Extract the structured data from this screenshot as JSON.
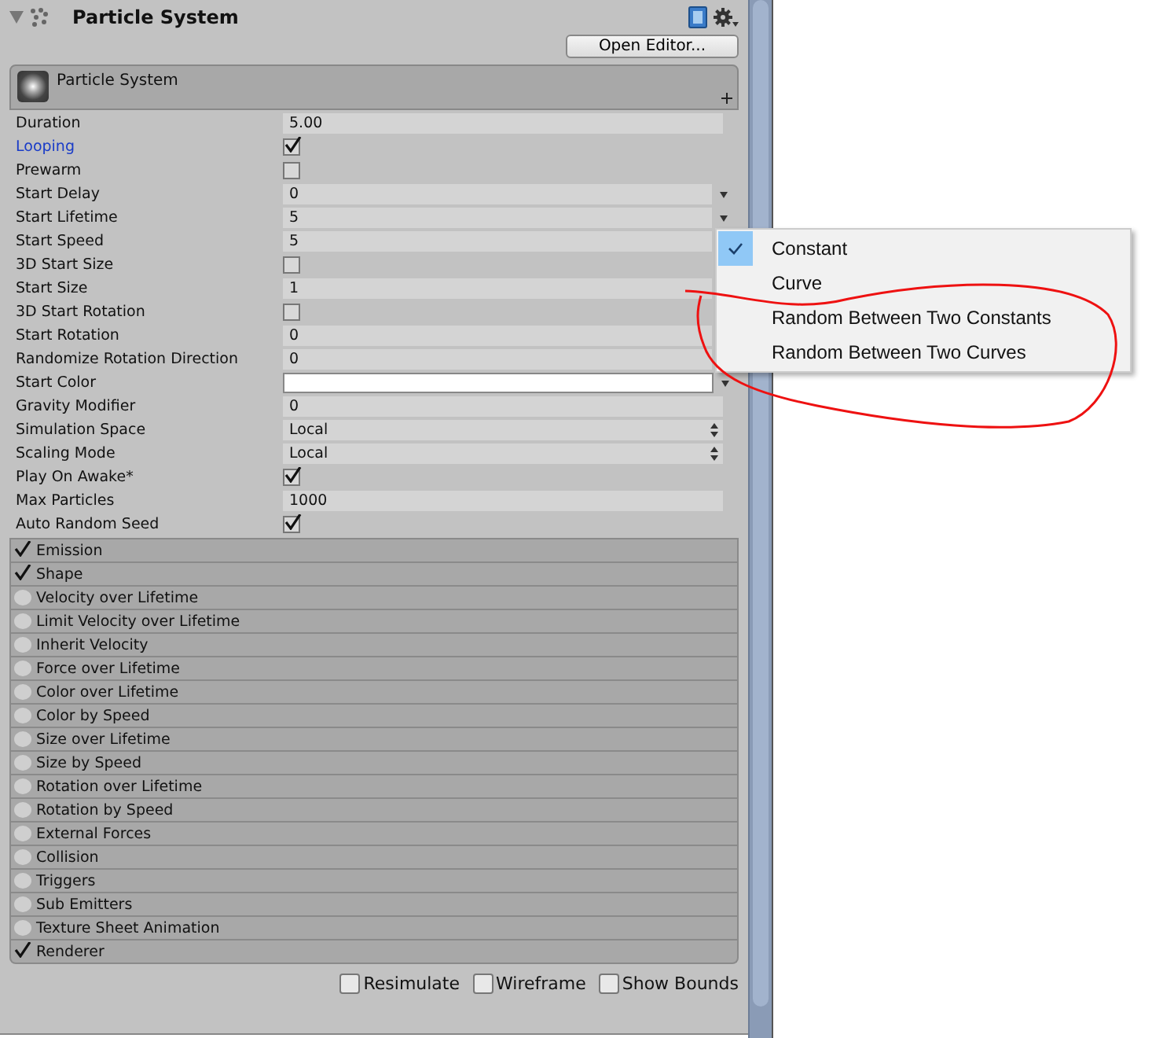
{
  "component": {
    "title": "Particle System",
    "button": "Open Editor..."
  },
  "module_header": {
    "title": "Particle System"
  },
  "properties": [
    {
      "label": "Duration",
      "kind": "number",
      "value": "5.00"
    },
    {
      "label": "Looping",
      "kind": "checkbox",
      "checked": true,
      "highlighted": true
    },
    {
      "label": "Prewarm",
      "kind": "checkbox",
      "checked": false
    },
    {
      "label": "Start Delay",
      "kind": "curve",
      "value": "0"
    },
    {
      "label": "Start Lifetime",
      "kind": "curve",
      "value": "5"
    },
    {
      "label": "Start Speed",
      "kind": "curve",
      "value": "5"
    },
    {
      "label": "3D Start Size",
      "kind": "checkbox",
      "checked": false
    },
    {
      "label": "Start Size",
      "kind": "curve",
      "value": "1"
    },
    {
      "label": "3D Start Rotation",
      "kind": "checkbox",
      "checked": false
    },
    {
      "label": "Start Rotation",
      "kind": "curve",
      "value": "0"
    },
    {
      "label": "Randomize Rotation Direction",
      "kind": "curve",
      "value": "0"
    },
    {
      "label": "Start Color",
      "kind": "color",
      "color": "#ffffff"
    },
    {
      "label": "Gravity Modifier",
      "kind": "number",
      "value": "0"
    },
    {
      "label": "Simulation Space",
      "kind": "enum",
      "value": "Local"
    },
    {
      "label": "Scaling Mode",
      "kind": "enum",
      "value": "Local"
    },
    {
      "label": "Play On Awake*",
      "kind": "checkbox",
      "checked": true
    },
    {
      "label": "Max Particles",
      "kind": "number",
      "value": "1000"
    },
    {
      "label": "Auto Random Seed",
      "kind": "checkbox",
      "checked": true
    }
  ],
  "modules": [
    {
      "label": "Emission",
      "enabled": true
    },
    {
      "label": "Shape",
      "enabled": true
    },
    {
      "label": "Velocity over Lifetime",
      "enabled": false
    },
    {
      "label": "Limit Velocity over Lifetime",
      "enabled": false
    },
    {
      "label": "Inherit Velocity",
      "enabled": false
    },
    {
      "label": "Force over Lifetime",
      "enabled": false
    },
    {
      "label": "Color over Lifetime",
      "enabled": false
    },
    {
      "label": "Color by Speed",
      "enabled": false
    },
    {
      "label": "Size over Lifetime",
      "enabled": false
    },
    {
      "label": "Size by Speed",
      "enabled": false
    },
    {
      "label": "Rotation over Lifetime",
      "enabled": false
    },
    {
      "label": "Rotation by Speed",
      "enabled": false
    },
    {
      "label": "External Forces",
      "enabled": false
    },
    {
      "label": "Collision",
      "enabled": false
    },
    {
      "label": "Triggers",
      "enabled": false
    },
    {
      "label": "Sub Emitters",
      "enabled": false
    },
    {
      "label": "Texture Sheet Animation",
      "enabled": false
    },
    {
      "label": "Renderer",
      "enabled": true
    }
  ],
  "footer": [
    {
      "label": "Resimulate",
      "checked": false
    },
    {
      "label": "Wireframe",
      "checked": false
    },
    {
      "label": "Show Bounds",
      "checked": false
    }
  ],
  "popup_menu": {
    "items": [
      {
        "label": "Constant",
        "selected": true
      },
      {
        "label": "Curve",
        "selected": false
      },
      {
        "label": "Random Between Two Constants",
        "selected": false
      },
      {
        "label": "Random Between Two Curves",
        "selected": false
      }
    ]
  }
}
